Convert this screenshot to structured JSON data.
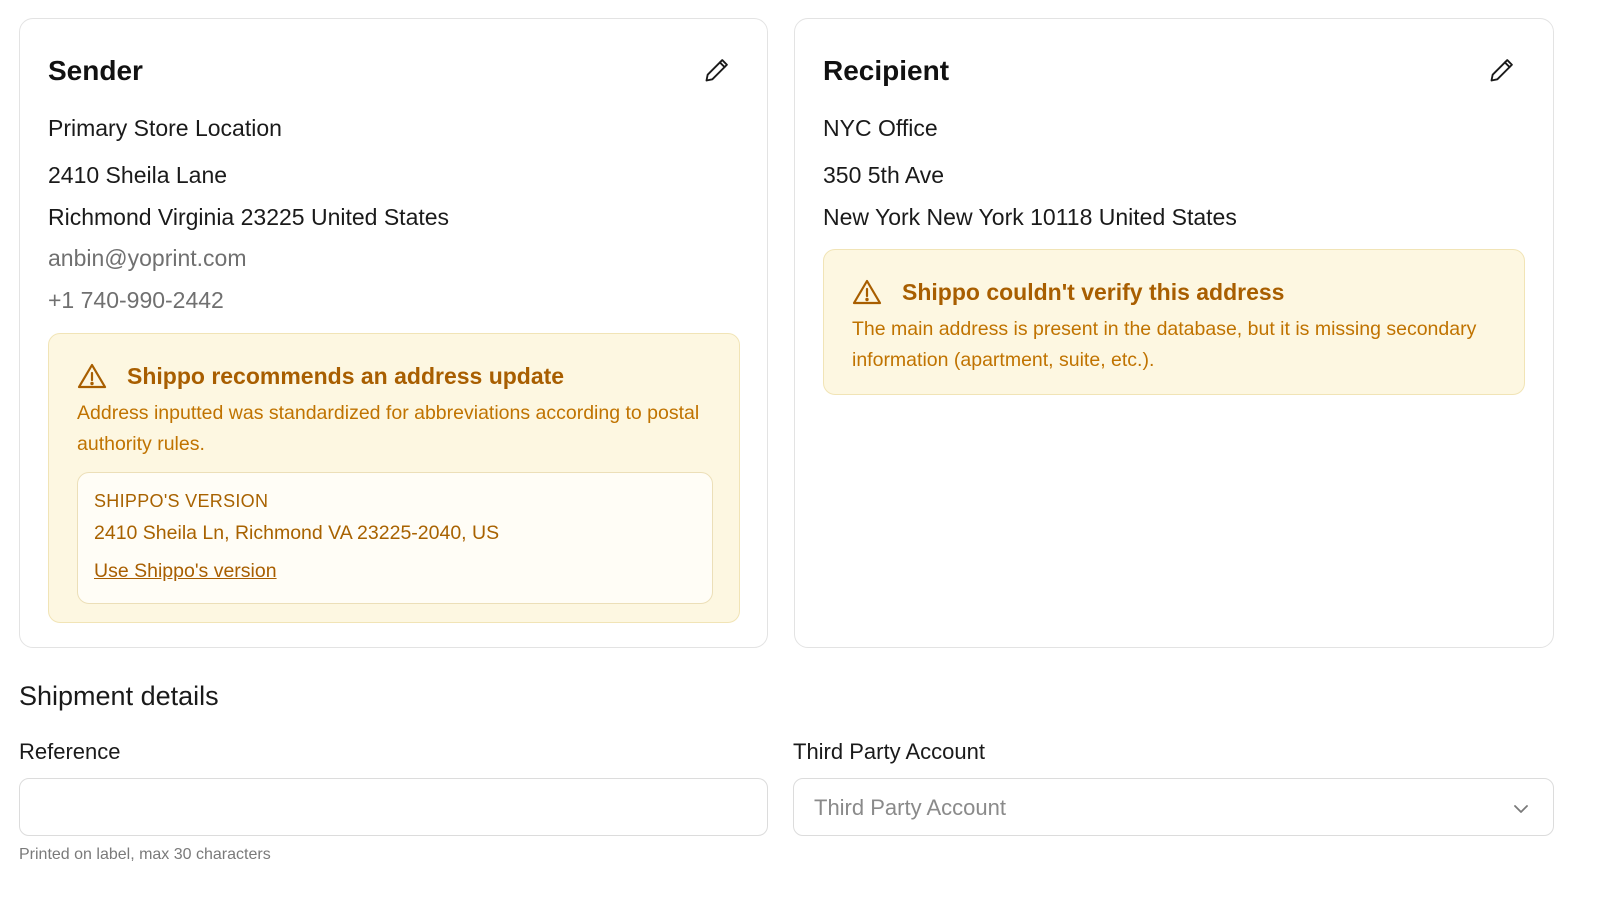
{
  "sender": {
    "title": "Sender",
    "edit_icon": "pencil-icon",
    "name": "Primary Store Location",
    "street": "2410 Sheila Lane",
    "city_line": "Richmond Virginia 23225 United States",
    "email": "anbin@yoprint.com",
    "phone": "+1 740-990-2442",
    "alert": {
      "icon": "warning-triangle-icon",
      "title": "Shippo recommends an address update",
      "body": "Address inputted was standardized for abbreviations according to postal authority rules.",
      "suggestion_label": "SHIPPO'S VERSION",
      "suggestion_address": "2410 Sheila Ln, Richmond VA 23225-2040, US",
      "suggestion_link": "Use Shippo's version"
    }
  },
  "recipient": {
    "title": "Recipient",
    "edit_icon": "pencil-icon",
    "name": "NYC Office",
    "street": "350 5th Ave",
    "city_line": "New York New York 10118 United States",
    "alert": {
      "icon": "warning-triangle-icon",
      "title": "Shippo couldn't verify this address",
      "body": "The main address is present in the database, but it is missing secondary information (apartment, suite, etc.)."
    }
  },
  "shipment": {
    "title": "Shipment details",
    "reference_label": "Reference",
    "reference_value": "",
    "reference_help": "Printed on label, max 30 characters",
    "third_party_label": "Third Party Account",
    "third_party_placeholder": "Third Party Account"
  },
  "colors": {
    "alert_bg": "#fdf7e1",
    "alert_text": "#c07300",
    "alert_title": "#a85e00"
  }
}
